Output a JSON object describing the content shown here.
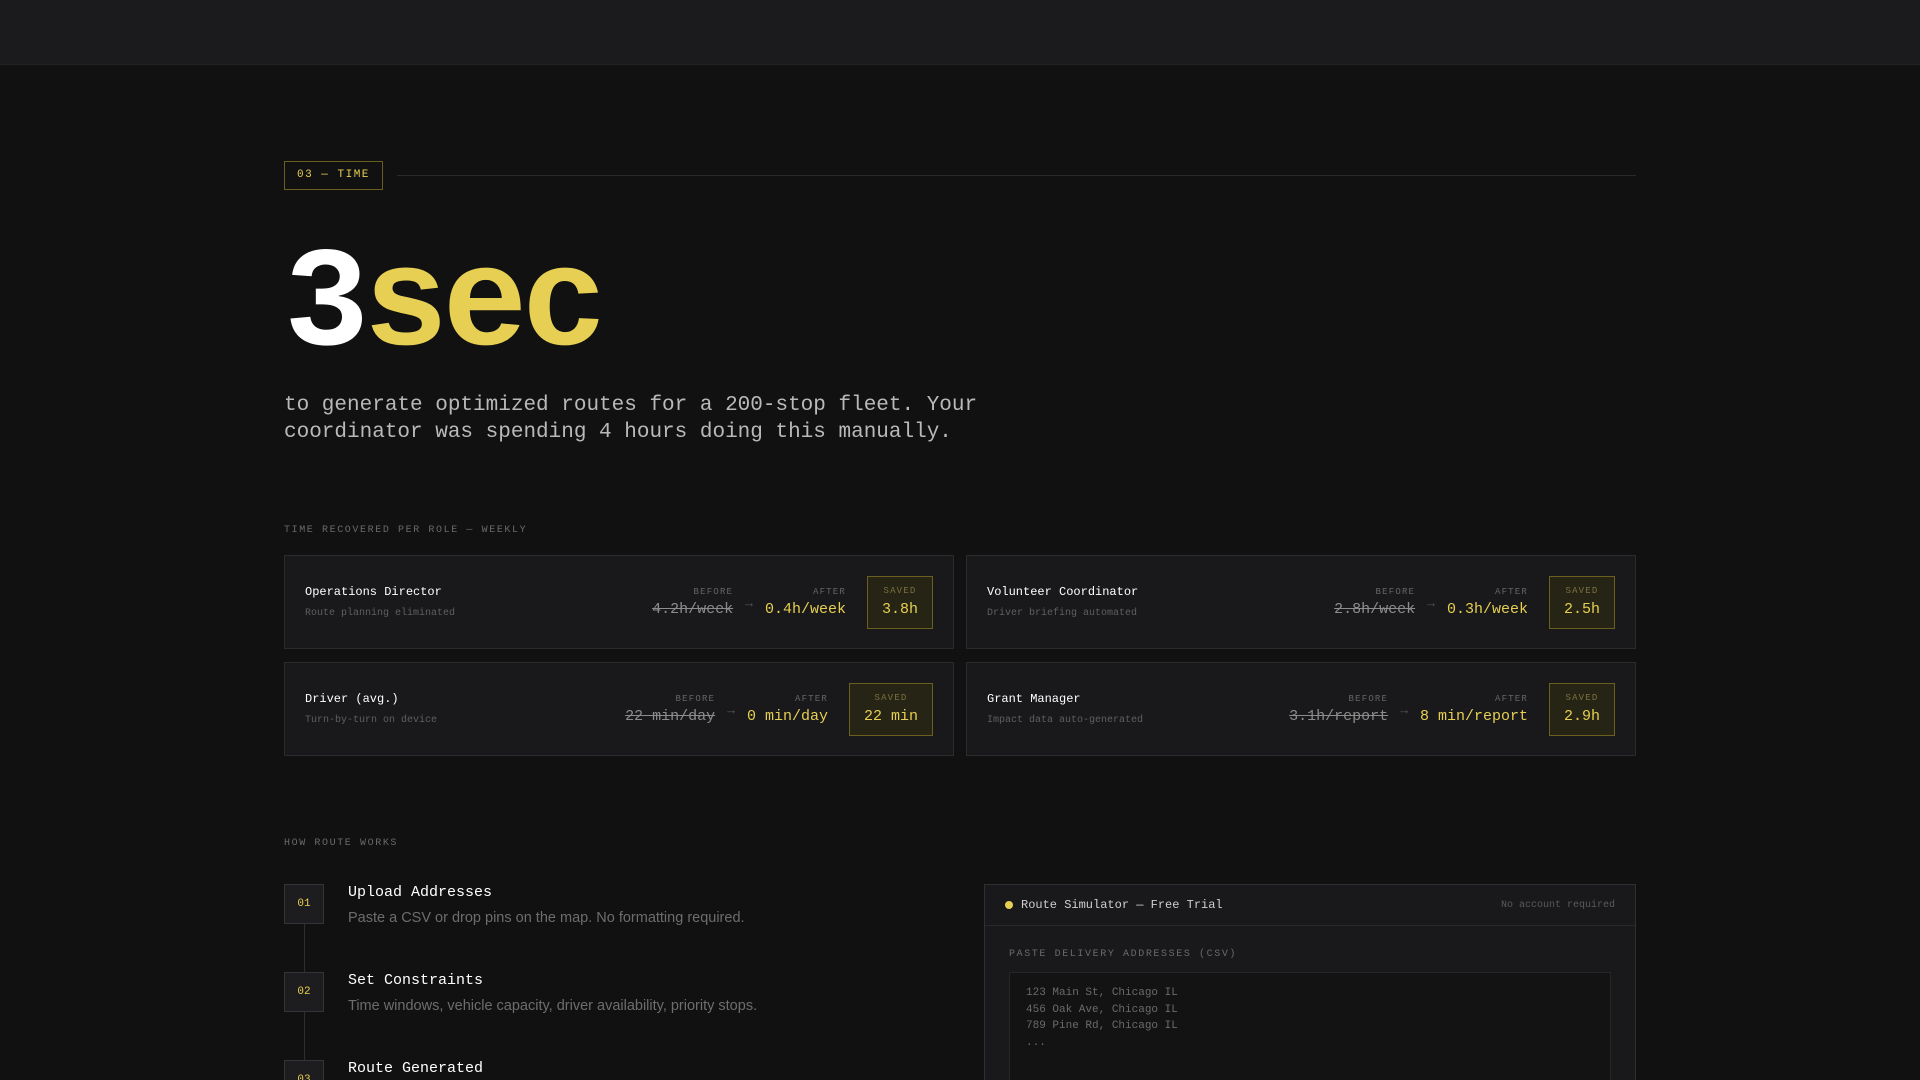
{
  "section_tag": "03 — TIME",
  "hero": {
    "number": "3",
    "unit": "sec",
    "description": "to generate optimized routes for a 200-stop fleet. Your coordinator was spending 4 hours doing this manually."
  },
  "roles_label": "TIME RECOVERED PER ROLE — WEEKLY",
  "metric_labels": {
    "before": "BEFORE",
    "after": "AFTER",
    "saved": "SAVED",
    "arrow": "→"
  },
  "roles": [
    {
      "title": "Operations Director",
      "subtitle": "Route planning eliminated",
      "before": "4.2h/week",
      "after": "0.4h/week",
      "saved": "3.8h"
    },
    {
      "title": "Volunteer Coordinator",
      "subtitle": "Driver briefing automated",
      "before": "2.8h/week",
      "after": "0.3h/week",
      "saved": "2.5h"
    },
    {
      "title": "Driver (avg.)",
      "subtitle": "Turn-by-turn on device",
      "before": "22 min/day",
      "after": "0 min/day",
      "saved": "22 min"
    },
    {
      "title": "Grant Manager",
      "subtitle": "Impact data auto-generated",
      "before": "3.1h/report",
      "after": "8 min/report",
      "saved": "2.9h"
    }
  ],
  "how_label": "HOW ROUTE WORKS",
  "steps": [
    {
      "num": "01",
      "title": "Upload Addresses",
      "desc": "Paste a CSV or drop pins on the map. No formatting required."
    },
    {
      "num": "02",
      "title": "Set Constraints",
      "desc": "Time windows, vehicle capacity, driver availability, priority stops."
    },
    {
      "num": "03",
      "title": "Route Generated",
      "desc": ""
    }
  ],
  "simulator": {
    "title": "Route Simulator — Free Trial",
    "note": "No account required",
    "input_label": "PASTE DELIVERY ADDRESSES (CSV)",
    "lines": [
      "123 Main St, Chicago IL",
      "456 Oak Ave, Chicago IL",
      "789 Pine Rd, Chicago IL",
      "..."
    ]
  },
  "colors": {
    "accent": "#e6cf52",
    "background": "#111112",
    "card": "#19191b"
  }
}
